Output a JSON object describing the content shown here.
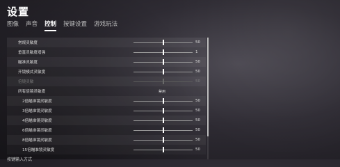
{
  "page": {
    "title": "设置"
  },
  "tabs": [
    {
      "label": "图像",
      "active": false
    },
    {
      "label": "声音",
      "active": false
    },
    {
      "label": "控制",
      "active": true
    },
    {
      "label": "按键设置",
      "active": false
    },
    {
      "label": "游戏玩法",
      "active": false
    }
  ],
  "settings": [
    {
      "label": "常规灵敏度",
      "value": "50",
      "level": 0.5,
      "disabled": false,
      "sub": false
    },
    {
      "label": "垂直灵敏度增强",
      "value": "1",
      "level": 0.5,
      "disabled": false,
      "sub": false
    },
    {
      "label": "瞄准灵敏度",
      "value": "50",
      "level": 0.5,
      "disabled": false,
      "sub": false
    },
    {
      "label": "开镜模式灵敏度",
      "value": "50",
      "level": 0.5,
      "disabled": false,
      "sub": false
    },
    {
      "label": "倍镜灵敏",
      "value": "50",
      "level": 0.5,
      "disabled": true,
      "sub": false
    },
    {
      "label": "所有倍镜灵敏度",
      "status": "禁用"
    },
    {
      "label": "2倍瞄准镜灵敏度",
      "value": "50",
      "level": 0.5,
      "disabled": false,
      "sub": true
    },
    {
      "label": "3倍瞄准镜灵敏度",
      "value": "50",
      "level": 0.5,
      "disabled": false,
      "sub": true
    },
    {
      "label": "4倍瞄准镜灵敏度",
      "value": "50",
      "level": 0.5,
      "disabled": false,
      "sub": true
    },
    {
      "label": "6倍瞄准镜灵敏度",
      "value": "50",
      "level": 0.5,
      "disabled": false,
      "sub": true
    },
    {
      "label": "8倍瞄准镜灵敏度",
      "value": "50",
      "level": 0.5,
      "disabled": false,
      "sub": true
    },
    {
      "label": "15倍瞄准镜灵敏度",
      "value": "50",
      "level": 0.5,
      "disabled": false,
      "sub": true
    }
  ],
  "footer": {
    "cutoff_label": "按键输入方式"
  }
}
